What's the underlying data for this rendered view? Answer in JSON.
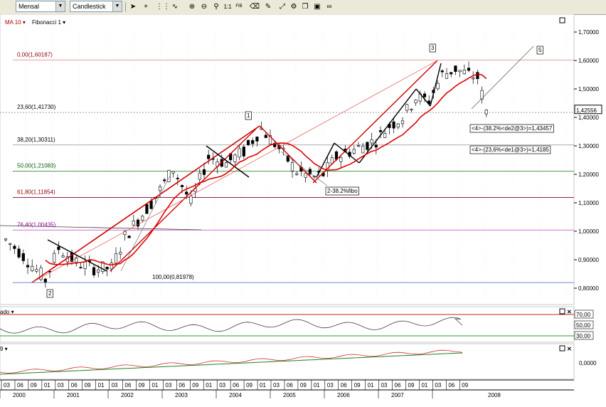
{
  "toolbar": {
    "period_value": "Mensal",
    "charttype_value": "Candlestick",
    "tool_11": "1:1",
    "tool_fib": "FIB"
  },
  "indicators": {
    "ma_label": "MA 10 ▾",
    "fib_label": "Fibonacci 1 ▾"
  },
  "price_axis": {
    "ticks": [
      "1,70000",
      "1,60000",
      "1,50000",
      "1,40000",
      "1,30000",
      "1,20000",
      "1,10000",
      "1,00000",
      "0,90000",
      "0,80000"
    ],
    "current_price": "1,42556"
  },
  "fib_levels": [
    {
      "label": "0,00(1,60187)",
      "color": "#d98080"
    },
    {
      "label": "23,60(1,41730)",
      "color": "#a0a0a0"
    },
    {
      "label": "38,20(1,30311)",
      "color": "#909090"
    },
    {
      "label": "50,00(1,21083)",
      "color": "#2e8b2e"
    },
    {
      "label": "61,80(1,11854)",
      "color": "#800040"
    },
    {
      "label": "76,40(1,00435)",
      "color": "#c040c0"
    },
    {
      "label": "100,00(0,81978)",
      "color": "#4060c0"
    }
  ],
  "wave_labels": {
    "w1": "1",
    "w2": "2",
    "w3": "3",
    "w5": "5"
  },
  "annotations": {
    "target1": "<4>-(38.2%<de2@3>)=1,43457",
    "target2": "<4>-(23,6%<de1@3>)=1,4185",
    "fibo_note": "2-38.2%fibo"
  },
  "rsi_panel": {
    "title": "ado ▾",
    "ticks": [
      "70,00",
      "50,00",
      "30,00"
    ]
  },
  "macd_panel": {
    "title": "9 ▾",
    "ticks": [
      "0,0000"
    ]
  },
  "x_axis": {
    "months": [
      "03",
      "06",
      "09",
      "01",
      "03",
      "06",
      "09",
      "01",
      "03",
      "06",
      "09",
      "01",
      "03",
      "06",
      "09",
      "01",
      "03",
      "06",
      "09",
      "01",
      "03",
      "06",
      "09",
      "01",
      "03",
      "06",
      "09",
      "01",
      "03",
      "06",
      "09",
      "01",
      "03",
      "06",
      "09"
    ],
    "years": [
      "2000",
      "2001",
      "2002",
      "2003",
      "2004",
      "2005",
      "2006",
      "2007",
      "2008"
    ]
  },
  "colors": {
    "candle": "#000000",
    "ma": "#e00000",
    "trend": "#cc0000",
    "bg": "#ffffff"
  }
}
